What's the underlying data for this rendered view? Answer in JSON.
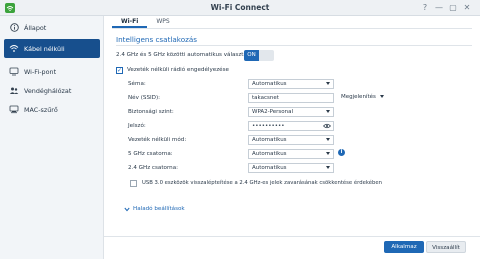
{
  "window": {
    "title": "Wi-Fi Connect",
    "controls": [
      "?",
      "—",
      "▢",
      "✕"
    ]
  },
  "sidebar": {
    "items": [
      {
        "label": "Állapot",
        "icon": "status-icon",
        "active": false
      },
      {
        "label": "Kábel nélküli",
        "icon": "wifi-icon",
        "active": true
      },
      {
        "label": "Wi-Fi-pont",
        "icon": "wifi-point-icon",
        "active": false
      },
      {
        "label": "Vendéghálózat",
        "icon": "guest-network-icon",
        "active": false
      },
      {
        "label": "MAC-szűrő",
        "icon": "mac-filter-icon",
        "active": false
      }
    ]
  },
  "tabs": [
    {
      "label": "Wi-Fi",
      "active": true
    },
    {
      "label": "WPS",
      "active": false
    }
  ],
  "section": {
    "title": "Intelligens csatlakozás"
  },
  "auto_switch": {
    "label": "2.4 GHz és 5 GHz közötti automatikus választás",
    "toggle_label": "ON"
  },
  "enable_wireless": {
    "label": "Vezeték nélküli rádió engedélyezése",
    "checked": true
  },
  "fields": {
    "schema": {
      "label": "Séma:",
      "value": "Automatikus"
    },
    "ssid": {
      "label": "Név (SSID):",
      "value": "takacsnet"
    },
    "hide_ssid": {
      "value": "Megjelenítés"
    },
    "security": {
      "label": "Biztonsági szint:",
      "value": "WPA2-Personal"
    },
    "password": {
      "label": "Jelszó:",
      "value": "••••••••••"
    },
    "mode": {
      "label": "Vezeték nélküli mód:",
      "value": "Automatikus"
    },
    "channel5": {
      "label": "5 GHz csatorna:",
      "value": "Automatikus"
    },
    "channel24": {
      "label": "2.4 GHz csatorna:",
      "value": "Automatikus"
    }
  },
  "usb_option": {
    "label": "USB 3.0 eszközök visszalépteítése a 2.4 GHz-es jelek zavarásának csökkentése érdekében",
    "checked": false
  },
  "advanced": {
    "label": "Haladó beállítások"
  },
  "footer": {
    "apply": "Alkalmaz",
    "reset": "Visszaállít"
  },
  "colors": {
    "accent": "#1f68b5",
    "sidebar_active": "#174f8d"
  }
}
